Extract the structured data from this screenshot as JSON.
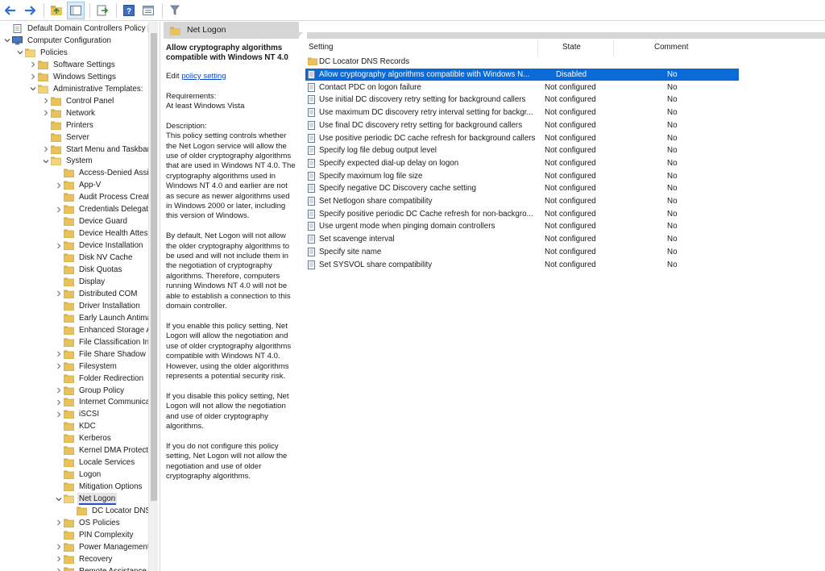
{
  "toolbar": {
    "buttons": [
      "back-icon",
      "forward-icon",
      "up-folder-icon",
      "show-hide-tree-icon",
      "export-list-icon",
      "help-icon",
      "properties-icon",
      "filter-icon"
    ]
  },
  "tree": {
    "root": "Default Domain Controllers Policy [DC",
    "computer_config": "Computer Configuration",
    "policies": "Policies",
    "software_settings": "Software Settings",
    "windows_settings": "Windows Settings",
    "admin_templates": "Administrative Templates:",
    "control_panel": "Control Panel",
    "network": "Network",
    "printers": "Printers",
    "server": "Server",
    "start_menu": "Start Menu and Taskbar",
    "system": "System",
    "system_children": [
      "Access-Denied Assistance",
      "App-V",
      "Audit Process Creation",
      "Credentials Delegation",
      "Device Guard",
      "Device Health Attestation",
      "Device Installation",
      "Disk NV Cache",
      "Disk Quotas",
      "Display",
      "Distributed COM",
      "Driver Installation",
      "Early Launch Antimalware",
      "Enhanced Storage Access",
      "File Classification Infrastructure",
      "File Share Shadow Copy",
      "Filesystem",
      "Folder Redirection",
      "Group Policy",
      "Internet Communication",
      "iSCSI",
      "KDC",
      "Kerberos",
      "Kernel DMA Protection",
      "Locale Services",
      "Logon",
      "Mitigation Options",
      "Net Logon"
    ],
    "net_logon_child": "DC Locator DNS Records",
    "after": [
      "OS Policies",
      "PIN Complexity",
      "Power Management",
      "Recovery",
      "Remote Assistance"
    ]
  },
  "header": {
    "title": "Net Logon"
  },
  "description": {
    "title": "Allow cryptography algorithms compatible with Windows NT 4.0",
    "edit_prefix": "Edit ",
    "edit_link": "policy setting",
    "requirements_label": "Requirements:",
    "requirements": "At least Windows Vista",
    "description_label": "Description:",
    "p1": "This policy setting controls whether the Net Logon service will allow the use of older cryptography algorithms that are used in Windows NT 4.0. The cryptography algorithms used in Windows NT 4.0 and earlier are not as secure as newer algorithms used in Windows 2000 or later, including this version of Windows.",
    "p2": "By default, Net Logon will not allow the older cryptography algorithms to be used and will not include them in the negotiation of cryptography algorithms. Therefore, computers running Windows NT 4.0 will not be able to establish a connection to this domain controller.",
    "p3": "If you enable this policy setting, Net Logon will allow the negotiation and use of older cryptography algorithms compatible with Windows NT 4.0. However, using the older algorithms represents a potential security risk.",
    "p4": "If you disable this policy setting, Net Logon will not allow the negotiation and use of older cryptography algorithms.",
    "p5": "If you do not configure this policy setting, Net Logon will not allow the negotiation and use of older cryptography algorithms."
  },
  "list": {
    "columns": {
      "setting": "Setting",
      "state": "State",
      "comment": "Comment"
    },
    "folder_row": "DC Locator DNS Records",
    "rows": [
      {
        "name": "Allow cryptography algorithms compatible with Windows N...",
        "state": "Disabled",
        "comment": "No"
      },
      {
        "name": "Contact PDC on logon failure",
        "state": "Not configured",
        "comment": "No"
      },
      {
        "name": "Use initial DC discovery retry setting for background callers",
        "state": "Not configured",
        "comment": "No"
      },
      {
        "name": "Use maximum DC discovery retry interval setting for backgr...",
        "state": "Not configured",
        "comment": "No"
      },
      {
        "name": "Use final DC discovery retry setting for background callers",
        "state": "Not configured",
        "comment": "No"
      },
      {
        "name": "Use positive periodic DC cache refresh for background callers",
        "state": "Not configured",
        "comment": "No"
      },
      {
        "name": "Specify log file debug output level",
        "state": "Not configured",
        "comment": "No"
      },
      {
        "name": "Specify expected dial-up delay on logon",
        "state": "Not configured",
        "comment": "No"
      },
      {
        "name": "Specify maximum log file size",
        "state": "Not configured",
        "comment": "No"
      },
      {
        "name": "Specify negative DC Discovery cache setting",
        "state": "Not configured",
        "comment": "No"
      },
      {
        "name": "Set Netlogon share compatibility",
        "state": "Not configured",
        "comment": "No"
      },
      {
        "name": "Specify positive periodic DC Cache refresh for non-backgro...",
        "state": "Not configured",
        "comment": "No"
      },
      {
        "name": "Use urgent mode when pinging domain controllers",
        "state": "Not configured",
        "comment": "No"
      },
      {
        "name": "Set scavenge interval",
        "state": "Not configured",
        "comment": "No"
      },
      {
        "name": "Specify site name",
        "state": "Not configured",
        "comment": "No"
      },
      {
        "name": "Set SYSVOL share compatibility",
        "state": "Not configured",
        "comment": "No"
      }
    ]
  },
  "colors": {
    "selection": "#0a6bd8",
    "folder": "#e8c25a",
    "link": "#0645c8"
  }
}
